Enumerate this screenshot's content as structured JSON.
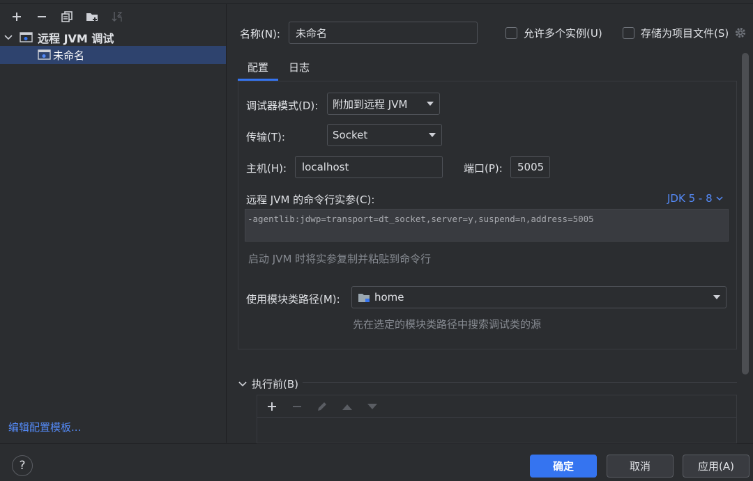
{
  "sidebar": {
    "toolbar": [
      "add-icon",
      "remove-icon",
      "copy-icon",
      "new-folder-icon",
      "sort-icon"
    ],
    "group_label": "远程 JVM 调试",
    "item_label": "未命名",
    "template_link": "编辑配置模板..."
  },
  "header": {
    "name_label": "名称(N):",
    "name_value": "未命名",
    "allow_multiple_label": "允许多个实例(U)",
    "store_as_project_label": "存储为项目文件(S)"
  },
  "tabs": [
    "配置",
    "日志"
  ],
  "config": {
    "debugger_mode_label": "调试器模式(D):",
    "debugger_mode_value": "附加到远程 JVM",
    "transport_label": "传输(T):",
    "transport_value": "Socket",
    "host_label": "主机(H):",
    "host_value": "localhost",
    "port_label": "端口(P):",
    "port_value": "5005",
    "cmdline_label": "远程 JVM 的命令行实参(C):",
    "jdk_selector": "JDK 5 - 8",
    "cmdline_value": "-agentlib:jdwp=transport=dt_socket,server=y,suspend=n,address=5005",
    "cmdline_hint": "启动 JVM 时将实参复制并粘贴到命令行",
    "module_label": "使用模块类路径(M):",
    "module_value": "home",
    "module_hint": "先在选定的模块类路径中搜索调试类的源"
  },
  "before_launch": {
    "label": "执行前(B)"
  },
  "footer": {
    "ok": "确定",
    "cancel": "取消",
    "apply": "应用(A)",
    "help": "?"
  },
  "colors": {
    "accent": "#3574f0",
    "link": "#548af7",
    "selection": "#2e436e",
    "background": "#2b2d30"
  }
}
